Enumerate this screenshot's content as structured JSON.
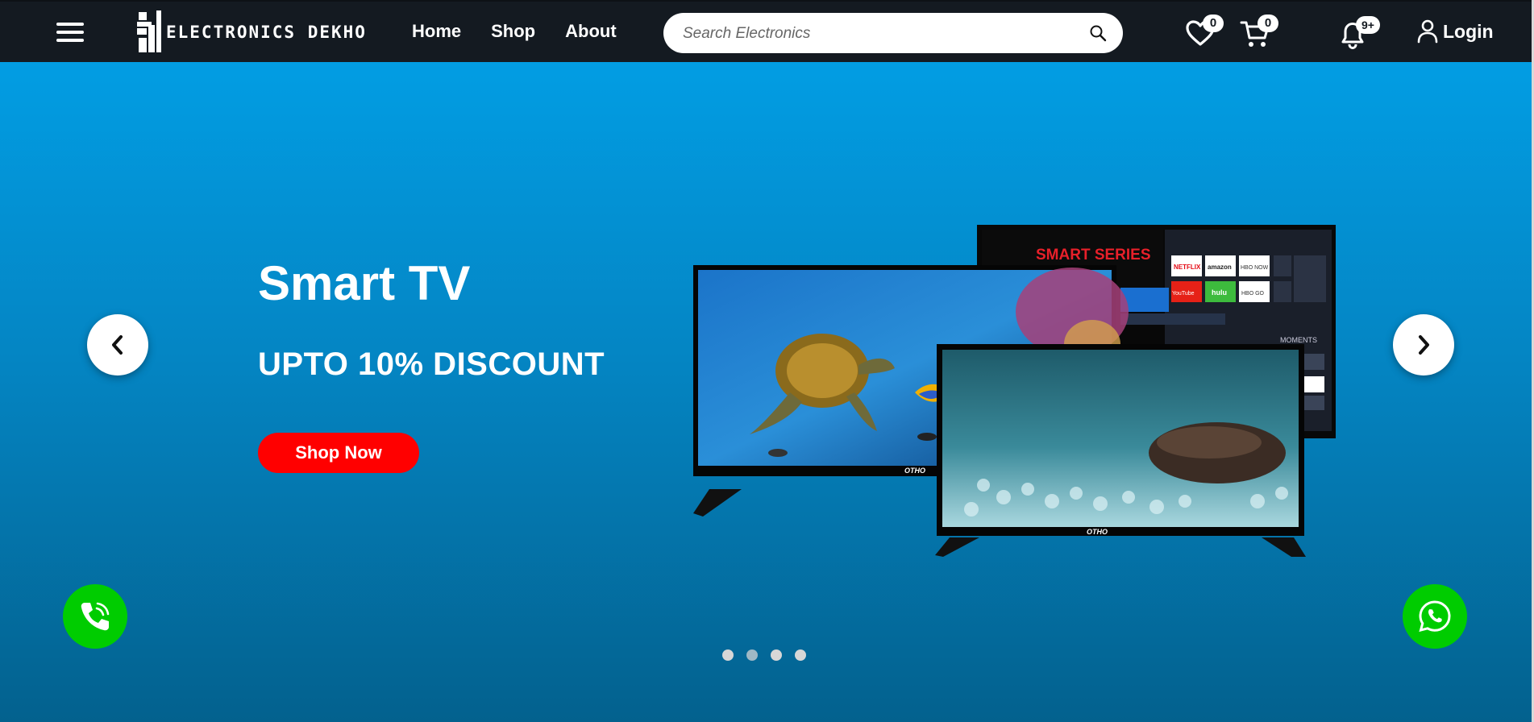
{
  "header": {
    "brand_name": "ELECTRONICS DEKHO",
    "nav": [
      "Home",
      "Shop",
      "About"
    ],
    "search_placeholder": "Search Electronics",
    "wishlist_count": "0",
    "cart_count": "0",
    "notification_count": "9+",
    "login_label": "Login"
  },
  "hero": {
    "title": "Smart TV",
    "subtitle": "UPTO 10% DISCOUNT",
    "cta_label": "Shop Now",
    "image_text": {
      "back_tv_banner": "SMART SERIES",
      "back_tv_moments": "MOMENTS",
      "tv_brand": "OTHO",
      "app_tiles": [
        "NETFLIX",
        "amazon",
        "HBO NOW",
        "YouTube",
        "hulu",
        "HBO GO"
      ]
    },
    "slides_total": 4,
    "active_slide": 1
  },
  "colors": {
    "navbar": "#141a21",
    "hero_top": "#029de3",
    "hero_bottom": "#03618e",
    "cta": "#ff0000",
    "fab": "#00cc00"
  },
  "icons": {
    "menu": "hamburger-icon",
    "search": "magnifier-icon",
    "wishlist": "heart-icon",
    "cart": "cart-icon",
    "notifications": "bell-icon",
    "login": "user-icon",
    "prev": "chevron-left-icon",
    "next": "chevron-right-icon",
    "call": "phone-icon",
    "whatsapp": "whatsapp-icon"
  }
}
